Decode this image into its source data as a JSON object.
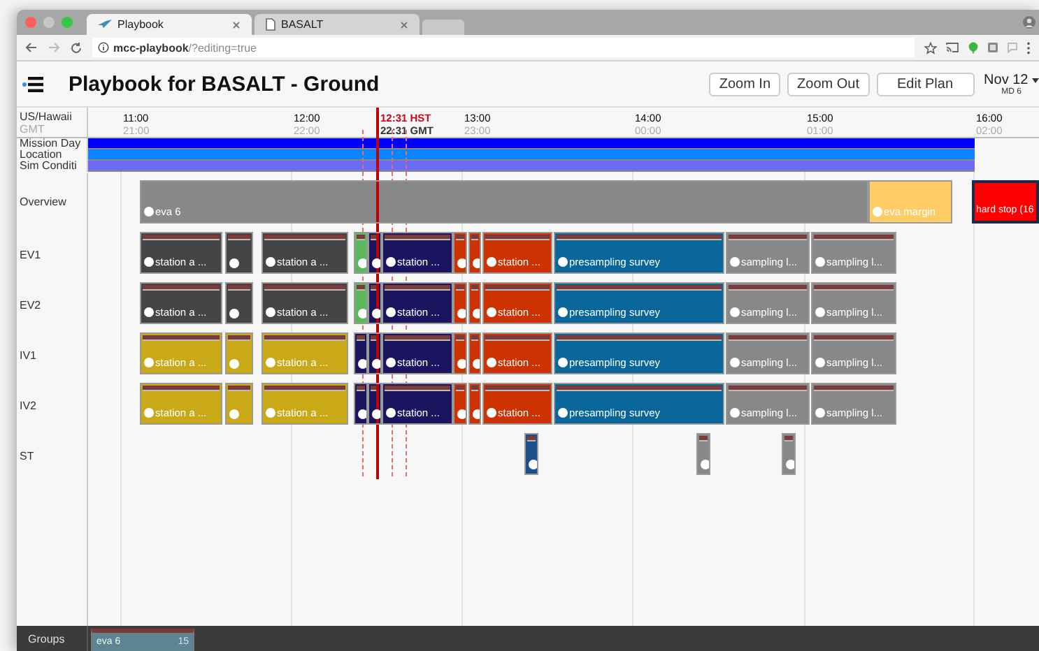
{
  "browser": {
    "tabs": [
      {
        "title": "Playbook",
        "selected": true
      },
      {
        "title": "BASALT",
        "selected": false
      }
    ],
    "url_host": "mcc-playbook",
    "url_path": "/?editing=true"
  },
  "header": {
    "title": "Playbook for BASALT - Ground",
    "buttons": [
      "Zoom In",
      "Zoom Out",
      "Edit Plan"
    ],
    "date": "Nov 12",
    "mission_day": "MD 6"
  },
  "timeline": {
    "zones": [
      "US/Hawaii",
      "GMT"
    ],
    "ticks": [
      {
        "local": "11:00",
        "gmt": "21:00"
      },
      {
        "local": "12:00",
        "gmt": "22:00"
      },
      {
        "local": "13:00",
        "gmt": "23:00"
      },
      {
        "local": "14:00",
        "gmt": "00:00"
      },
      {
        "local": "15:00",
        "gmt": "01:00"
      },
      {
        "local": "16:00",
        "gmt": "02:00"
      }
    ],
    "now": {
      "local": "12:31 HST",
      "gmt": "22:31 GMT"
    },
    "bands": [
      {
        "label": "Mission Day",
        "color": "#0000ff"
      },
      {
        "label": "Location",
        "color": "#0a84ff"
      },
      {
        "label": "Sim Conditi",
        "color": "#6b6bf2"
      }
    ],
    "rows": [
      {
        "label": "Overview",
        "activities": [
          {
            "kind": "span",
            "label": "eva 6",
            "color": "#87888a"
          },
          {
            "kind": "span",
            "label": "eva margin",
            "color": "#ffcc66"
          },
          {
            "kind": "limit",
            "label": "hard stop (16",
            "color": "#ff0000"
          }
        ]
      },
      {
        "label": "EV1",
        "activities": [
          {
            "kind": "task",
            "label": "station a ...",
            "color": "#444546"
          },
          {
            "kind": "task",
            "color": "#444546"
          },
          {
            "kind": "task",
            "label": "station a ...",
            "color": "#444546"
          },
          {
            "kind": "task",
            "color": "#5cb85c"
          },
          {
            "kind": "task",
            "color": "#1b1560"
          },
          {
            "kind": "task",
            "label": "station ...",
            "color": "#1b1560"
          },
          {
            "kind": "task",
            "color": "#cc3300"
          },
          {
            "kind": "task",
            "color": "#cc3300"
          },
          {
            "kind": "task",
            "label": "station ...",
            "color": "#cc3300"
          },
          {
            "kind": "task",
            "label": "presampling survey",
            "color": "#086699"
          },
          {
            "kind": "task",
            "label": "sampling l...",
            "color": "#87888a"
          },
          {
            "kind": "task",
            "label": "sampling l...",
            "color": "#87888a"
          }
        ]
      },
      {
        "label": "EV2",
        "activities": [
          {
            "kind": "task",
            "label": "station a ...",
            "color": "#444546"
          },
          {
            "kind": "task",
            "color": "#444546"
          },
          {
            "kind": "task",
            "label": "station a ...",
            "color": "#444546"
          },
          {
            "kind": "task",
            "color": "#5cb85c"
          },
          {
            "kind": "task",
            "color": "#1b1560"
          },
          {
            "kind": "task",
            "label": "station ...",
            "color": "#1b1560"
          },
          {
            "kind": "task",
            "color": "#cc3300"
          },
          {
            "kind": "task",
            "color": "#cc3300"
          },
          {
            "kind": "task",
            "label": "station ...",
            "color": "#cc3300"
          },
          {
            "kind": "task",
            "label": "presampling survey",
            "color": "#086699"
          },
          {
            "kind": "task",
            "label": "sampling l...",
            "color": "#87888a"
          },
          {
            "kind": "task",
            "label": "sampling l...",
            "color": "#87888a"
          }
        ]
      },
      {
        "label": "IV1",
        "activities": [
          {
            "kind": "task",
            "label": "station a ...",
            "color": "#c9a917"
          },
          {
            "kind": "task",
            "color": "#c9a917"
          },
          {
            "kind": "task",
            "label": "station a ...",
            "color": "#c9a917"
          },
          {
            "kind": "task",
            "color": "#1b1560"
          },
          {
            "kind": "task",
            "color": "#1b1560"
          },
          {
            "kind": "task",
            "label": "station ...",
            "color": "#1b1560"
          },
          {
            "kind": "task",
            "color": "#cc3300"
          },
          {
            "kind": "task",
            "color": "#cc3300"
          },
          {
            "kind": "task",
            "label": "station ...",
            "color": "#cc3300"
          },
          {
            "kind": "task",
            "label": "presampling survey",
            "color": "#086699"
          },
          {
            "kind": "task",
            "label": "sampling l...",
            "color": "#87888a"
          },
          {
            "kind": "task",
            "label": "sampling l...",
            "color": "#87888a"
          }
        ]
      },
      {
        "label": "IV2",
        "activities": [
          {
            "kind": "task",
            "label": "station a ...",
            "color": "#c9a917"
          },
          {
            "kind": "task",
            "color": "#c9a917"
          },
          {
            "kind": "task",
            "label": "station a ...",
            "color": "#c9a917"
          },
          {
            "kind": "task",
            "color": "#1b1560"
          },
          {
            "kind": "task",
            "color": "#1b1560"
          },
          {
            "kind": "task",
            "label": "station ...",
            "color": "#1b1560"
          },
          {
            "kind": "task",
            "color": "#cc3300"
          },
          {
            "kind": "task",
            "color": "#cc3300"
          },
          {
            "kind": "task",
            "label": "station ...",
            "color": "#cc3300"
          },
          {
            "kind": "task",
            "label": "presampling survey",
            "color": "#086699"
          },
          {
            "kind": "task",
            "label": "sampling l...",
            "color": "#87888a"
          },
          {
            "kind": "task",
            "label": "sampling l...",
            "color": "#87888a"
          }
        ]
      },
      {
        "label": "ST",
        "activities": [
          {
            "kind": "task",
            "color": "#1a4f8a"
          },
          {
            "kind": "task",
            "color": "#87888a"
          },
          {
            "kind": "task",
            "color": "#87888a"
          }
        ]
      }
    ]
  },
  "groups": {
    "label": "Groups",
    "items": [
      {
        "name": "eva 6",
        "count": "15"
      }
    ]
  }
}
